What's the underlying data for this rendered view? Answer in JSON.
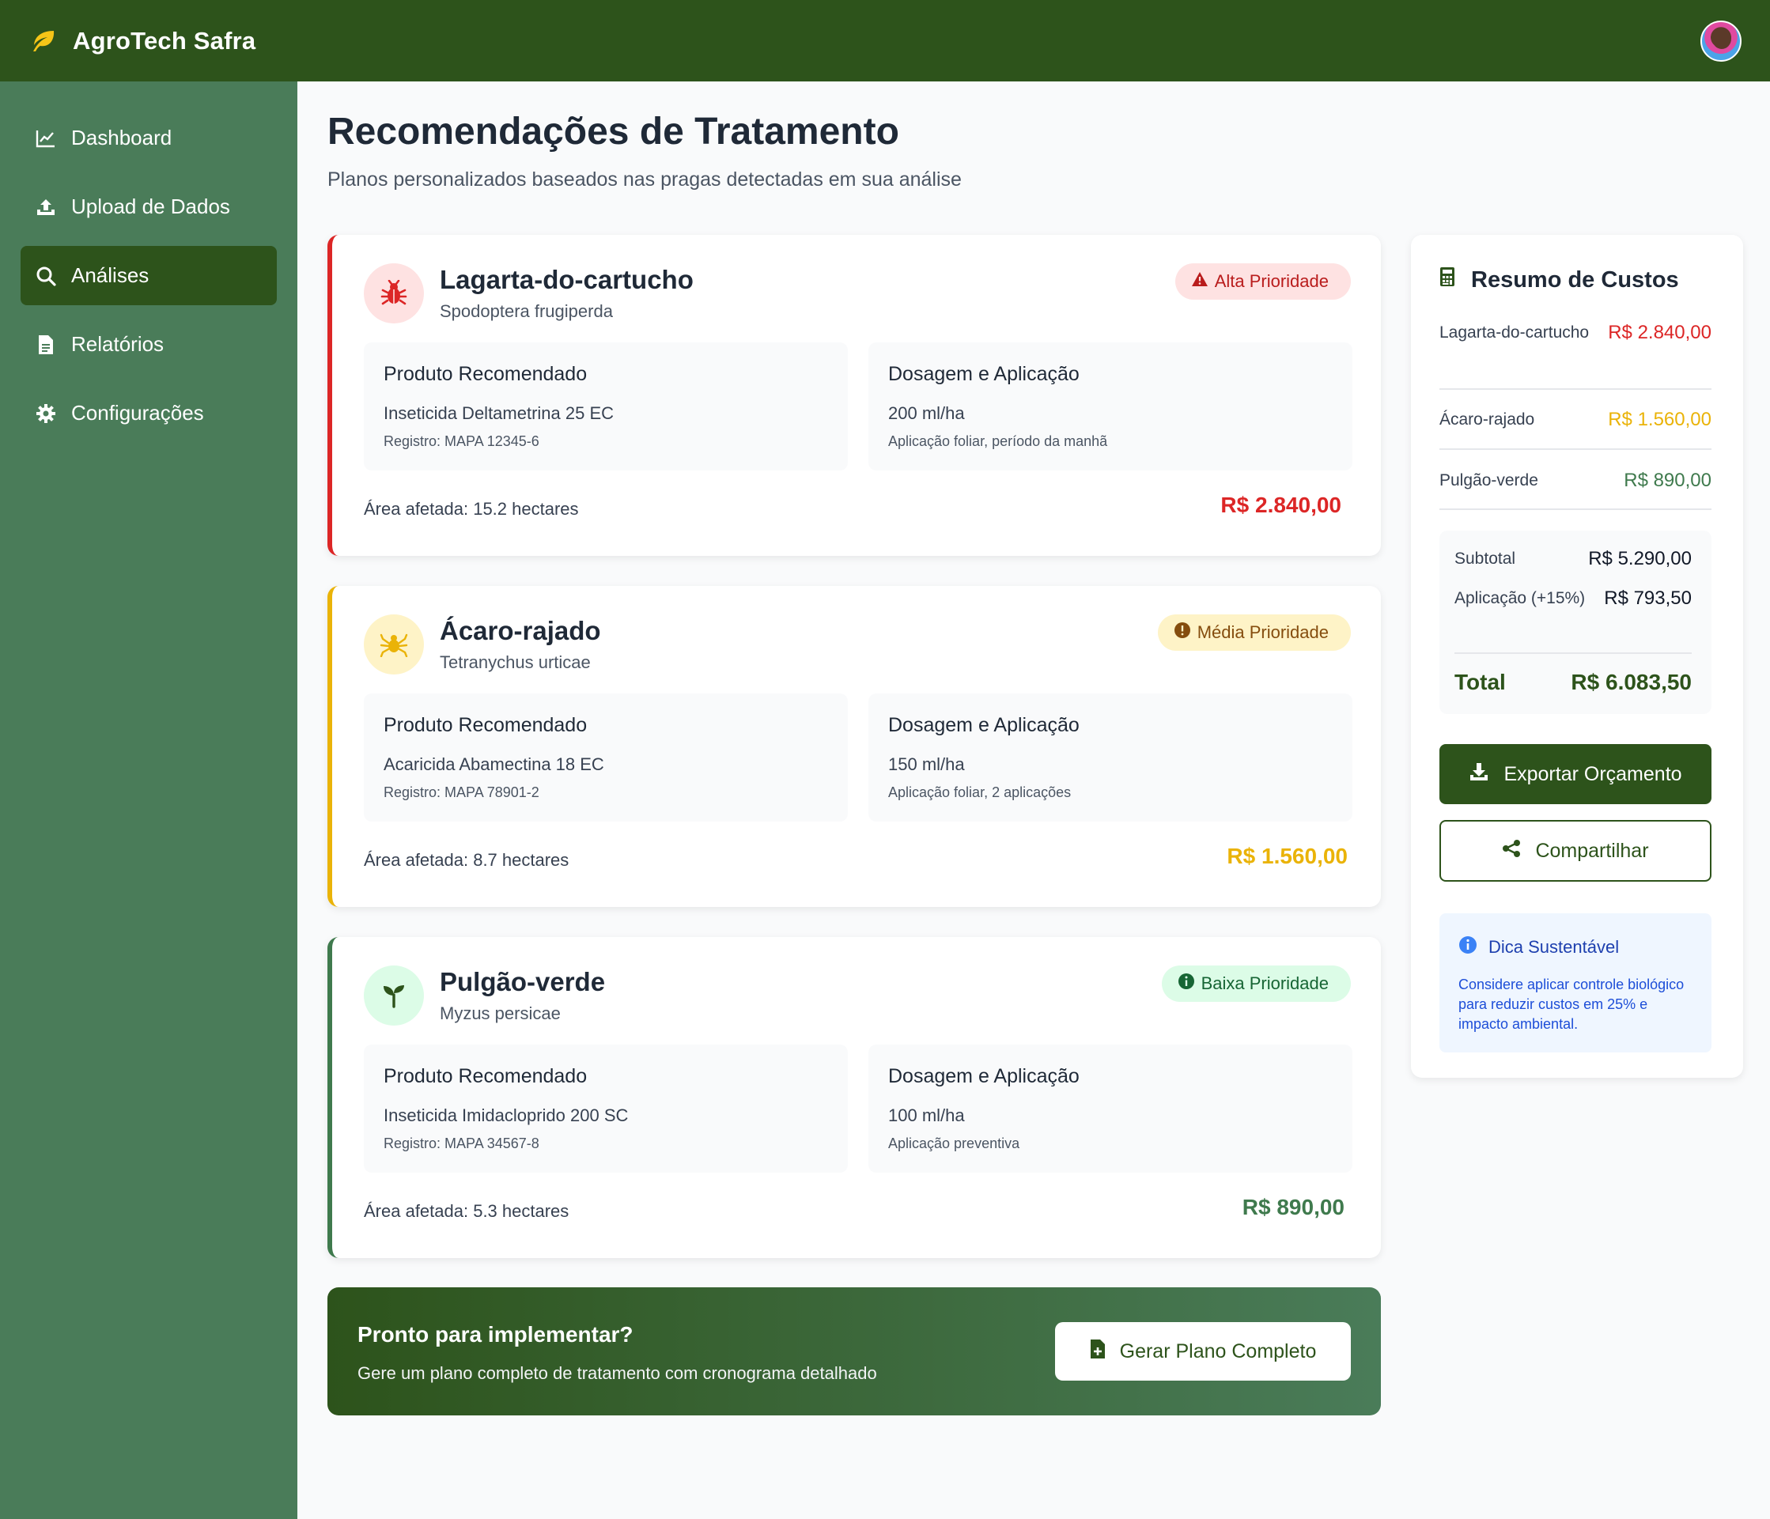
{
  "app": {
    "title": "AgroTech Safra"
  },
  "sidebar": {
    "items": [
      {
        "label": "Dashboard",
        "icon": "chart-line-icon",
        "active": false
      },
      {
        "label": "Upload de Dados",
        "icon": "upload-icon",
        "active": false
      },
      {
        "label": "Análises",
        "icon": "search-icon",
        "active": true
      },
      {
        "label": "Relatórios",
        "icon": "file-icon",
        "active": false
      },
      {
        "label": "Configurações",
        "icon": "gear-icon",
        "active": false
      }
    ]
  },
  "page": {
    "title": "Recomendações de Tratamento",
    "subtitle": "Planos personalizados baseados nas pragas detectadas em sua análise"
  },
  "labels": {
    "product": "Produto Recomendado",
    "dosage": "Dosagem e Aplicação"
  },
  "pests": [
    {
      "name": "Lagarta-do-cartucho",
      "scientific": "Spodoptera frugiperda",
      "priority": "Alta Prioridade",
      "product": "Inseticida Deltametrina 25 EC",
      "registry": "Registro: MAPA 12345-6",
      "dose": "200 ml/ha",
      "application": "Aplicação foliar, período da manhã",
      "area": "Área afetada: 15.2 hectares",
      "cost": "R$ 2.840,00",
      "icon": "bug-icon",
      "color": "#dc2626"
    },
    {
      "name": "Ácaro-rajado",
      "scientific": "Tetranychus urticae",
      "priority": "Média Prioridade",
      "product": "Acaricida Abamectina 18 EC",
      "registry": "Registro: MAPA 78901-2",
      "dose": "150 ml/ha",
      "application": "Aplicação foliar, 2 aplicações",
      "area": "Área afetada: 8.7 hectares",
      "cost": "R$ 1.560,00",
      "icon": "spider-icon",
      "color": "#eab308"
    },
    {
      "name": "Pulgão-verde",
      "scientific": "Myzus persicae",
      "priority": "Baixa Prioridade",
      "product": "Inseticida Imidacloprido 200 SC",
      "registry": "Registro: MAPA 34567-8",
      "dose": "100 ml/ha",
      "application": "Aplicação preventiva",
      "area": "Área afetada: 5.3 hectares",
      "cost": "R$ 890,00",
      "icon": "seedling-icon",
      "color": "#3f7a4d"
    }
  ],
  "cta": {
    "title": "Pronto para implementar?",
    "subtitle": "Gere um plano completo de tratamento com cronograma detalhado",
    "button": "Gerar Plano Completo"
  },
  "summary": {
    "title": "Resumo de Custos",
    "rows": [
      {
        "label": "Lagarta-do-cartucho",
        "value": "R$ 2.840,00"
      },
      {
        "label": "Ácaro-rajado",
        "value": "R$ 1.560,00"
      },
      {
        "label": "Pulgão-verde",
        "value": "R$ 890,00"
      }
    ],
    "subtotal_label": "Subtotal",
    "subtotal_value": "R$ 5.290,00",
    "application_label": "Aplicação (+15%)",
    "application_value": "R$ 793,50",
    "total_label": "Total",
    "total_value": "R$ 6.083,50",
    "export_button": "Exportar Orçamento",
    "share_button": "Compartilhar",
    "tip_title": "Dica Sustentável",
    "tip_text": "Considere aplicar controle biológico para reduzir custos em 25% e impacto ambiental."
  },
  "colors": {
    "brand": "#2d531b",
    "sidebar": "#4a7c59",
    "high": "#dc2626",
    "medium": "#eab308",
    "low": "#3f7a4d",
    "accent_leaf": "#f5c518"
  }
}
